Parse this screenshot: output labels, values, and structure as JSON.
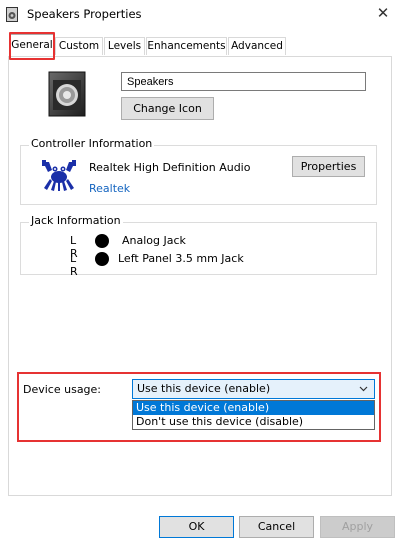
{
  "window": {
    "title": "Speakers Properties",
    "close_glyph": "✕"
  },
  "tabs": [
    {
      "label": "General",
      "active": true
    },
    {
      "label": "Custom",
      "active": false
    },
    {
      "label": "Levels",
      "active": false
    },
    {
      "label": "Enhancements",
      "active": false
    },
    {
      "label": "Advanced",
      "active": false
    }
  ],
  "device": {
    "icon": "speaker-icon",
    "name_value": "Speakers",
    "change_icon_label": "Change Icon"
  },
  "controller": {
    "group_label": "Controller Information",
    "description": "Realtek High Definition Audio",
    "vendor_link": "Realtek",
    "properties_label": "Properties",
    "logo": "realtek-crab-icon"
  },
  "jack": {
    "group_label": "Jack Information",
    "rows": [
      {
        "channels": "L R",
        "label": "Analog Jack",
        "color": "#000000"
      },
      {
        "channels": "L R",
        "label": "Left Panel 3.5 mm Jack",
        "color": "#000000"
      }
    ]
  },
  "usage": {
    "label": "Device usage:",
    "selected_value": "Use this device (enable)",
    "options": [
      {
        "label": "Use this device (enable)",
        "selected": true
      },
      {
        "label": "Don't use this device (disable)",
        "selected": false
      }
    ],
    "highlight_color": "#e63232"
  },
  "footer": {
    "ok_label": "OK",
    "cancel_label": "Cancel",
    "apply_label": "Apply",
    "apply_enabled": false
  },
  "colors": {
    "accent": "#0078d7",
    "link": "#1565c0",
    "highlight": "#e63232"
  }
}
